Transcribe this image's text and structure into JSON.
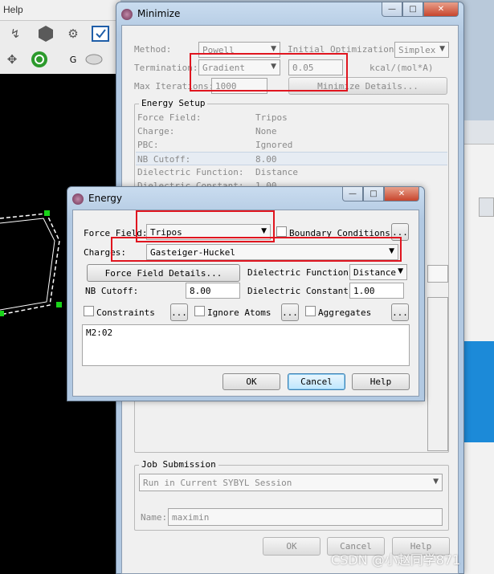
{
  "background_app": {
    "menu_label": "Help",
    "toolbar_icons": [
      "link-chain-icon",
      "molecule-icon",
      "tweezers-icon",
      "checkbox-window-icon",
      "move-arrows-icon",
      "refresh-icon",
      "g-label-icon",
      "mouse-icon"
    ],
    "toolbar_text": "G"
  },
  "minimize": {
    "title": "Minimize",
    "method_label": "Method:",
    "method_value": "Powell",
    "initial_opt_label": "Initial Optimization:",
    "initial_opt_value": "Simplex",
    "termination_label": "Termination:",
    "termination_value": "Gradient",
    "gradient_value": "0.05",
    "gradient_unit": "kcal/(mol*A)",
    "max_iter_label": "Max Iterations:",
    "max_iter_value": "1000",
    "details_button": "Minimize Details...",
    "energy_setup_title": "Energy Setup",
    "energy_rows": [
      {
        "key": "Force Field:",
        "value": "Tripos"
      },
      {
        "key": "Charge:",
        "value": "None"
      },
      {
        "key": "PBC:",
        "value": "Ignored"
      },
      {
        "key": "NB Cutoff:",
        "value": "8.00"
      },
      {
        "key": "Dielectric Function:",
        "value": "Distance"
      },
      {
        "key": "Dielectric Constant:",
        "value": "1.00"
      }
    ],
    "job_submission_title": "Job Submission",
    "job_mode_value": "Run in Current SYBYL Session",
    "name_label": "Name:",
    "name_value": "maximin",
    "ok_label": "OK",
    "cancel_label": "Cancel",
    "help_label": "Help"
  },
  "energy": {
    "title": "Energy",
    "force_field_label": "Force Field:",
    "force_field_value": "Tripos",
    "boundary_label": "Boundary Conditions",
    "ellipsis": "...",
    "charges_label": "Charges:",
    "charges_value": "Gasteiger-Huckel",
    "ff_details_button": "Force Field Details...",
    "dielectric_function_label": "Dielectric Function:",
    "dielectric_function_value": "Distance",
    "nb_cutoff_label": "NB Cutoff:",
    "nb_cutoff_value": "8.00",
    "dielectric_constant_label": "Dielectric Constant:",
    "dielectric_constant_value": "1.00",
    "constraints_label": "Constraints",
    "ignore_atoms_label": "Ignore Atoms",
    "aggregates_label": "Aggregates",
    "list_item": "M2:02",
    "ok_label": "OK",
    "cancel_label": "Cancel",
    "help_label": "Help"
  },
  "watermark": "CSDN @小赵同学871",
  "colors": {
    "highlight": "#e0151f",
    "window_frame": "#b2c9e2",
    "dialog_bg": "#f0f0f0"
  }
}
